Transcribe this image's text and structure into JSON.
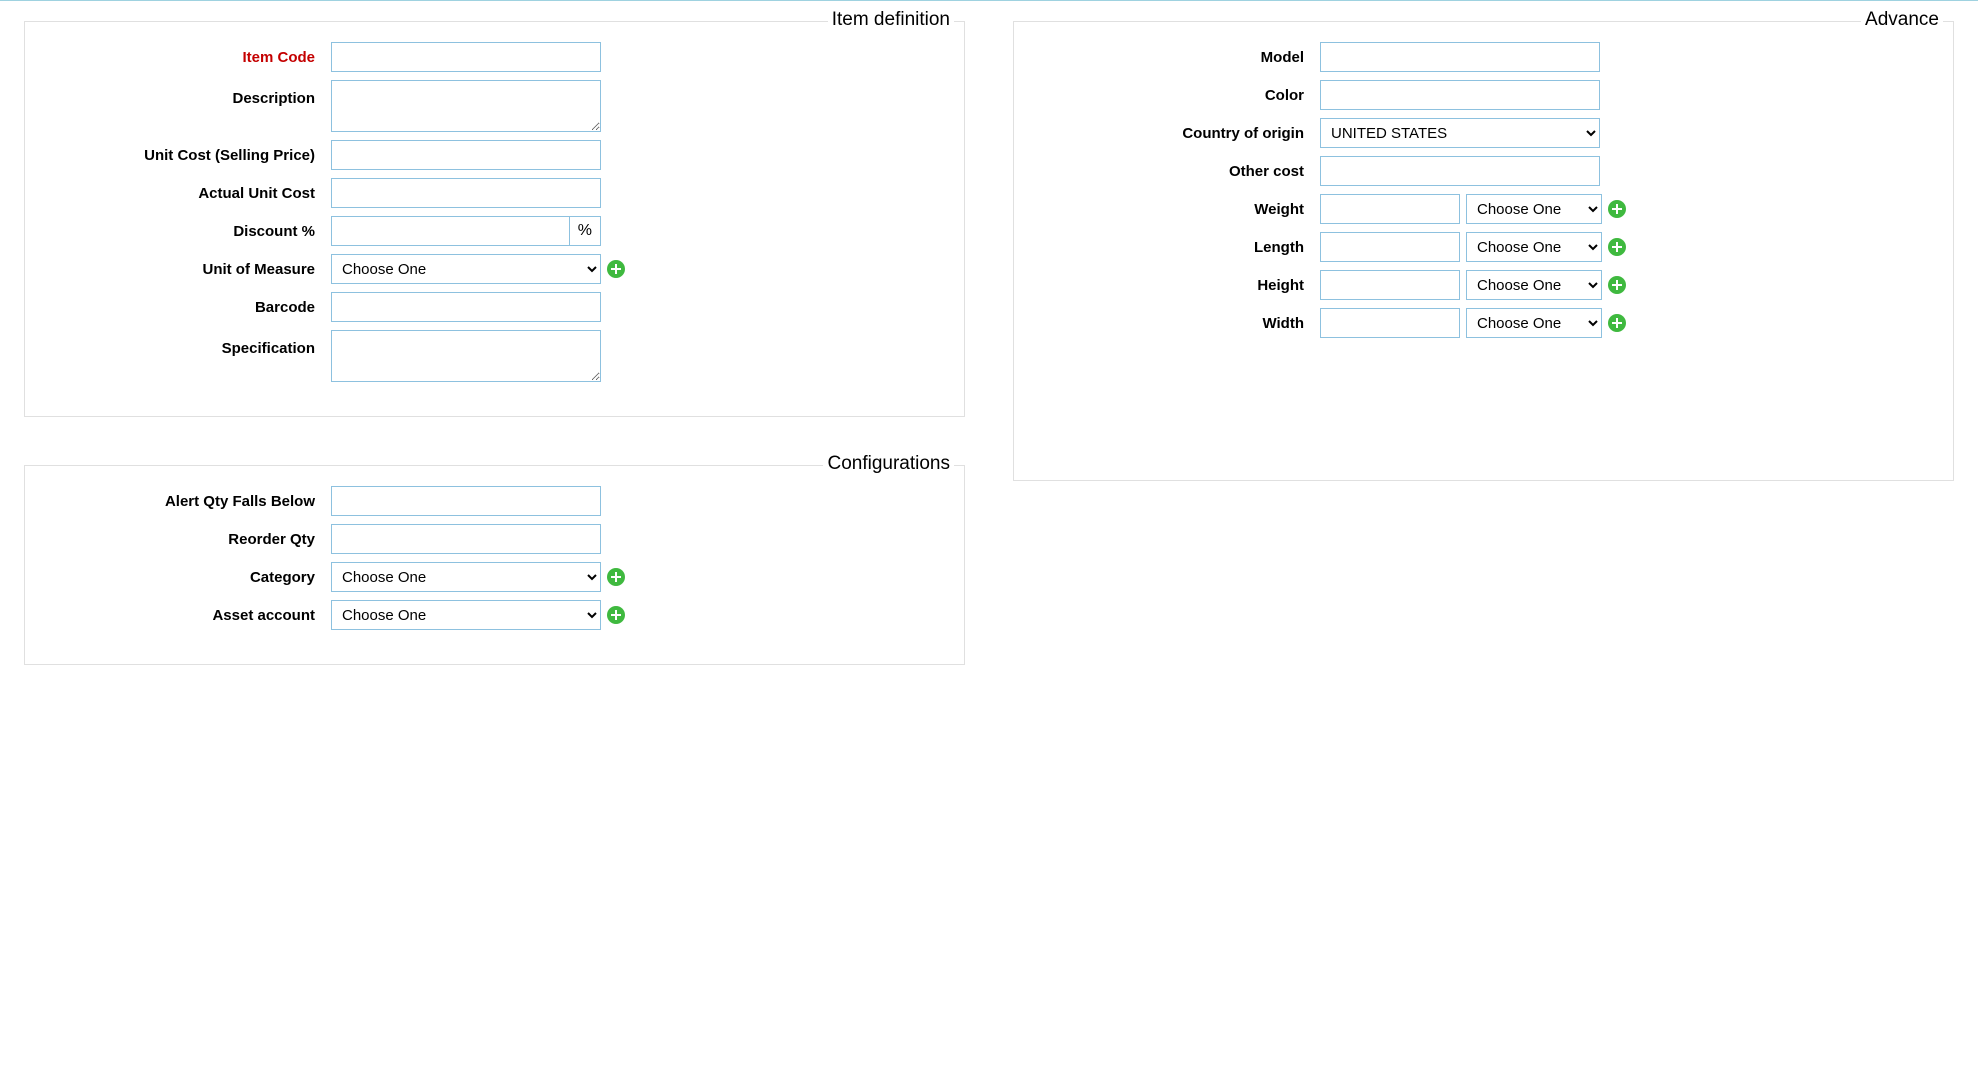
{
  "panels": {
    "item_definition": {
      "legend": "Item definition"
    },
    "configurations": {
      "legend": "Configurations"
    },
    "advance": {
      "legend": "Advance"
    }
  },
  "item_definition": {
    "item_code": {
      "label": "Item Code",
      "value": ""
    },
    "description": {
      "label": "Description",
      "value": ""
    },
    "unit_cost_selling": {
      "label": "Unit Cost (Selling Price)",
      "value": ""
    },
    "actual_unit_cost": {
      "label": "Actual Unit Cost",
      "value": ""
    },
    "discount_pct": {
      "label": "Discount %",
      "value": "",
      "suffix": "%"
    },
    "unit_of_measure": {
      "label": "Unit of Measure",
      "selected": "Choose One"
    },
    "barcode": {
      "label": "Barcode",
      "value": ""
    },
    "specification": {
      "label": "Specification",
      "value": ""
    }
  },
  "configurations": {
    "alert_qty": {
      "label": "Alert Qty Falls Below",
      "value": ""
    },
    "reorder_qty": {
      "label": "Reorder Qty",
      "value": ""
    },
    "category": {
      "label": "Category",
      "selected": "Choose One"
    },
    "asset_account": {
      "label": "Asset account",
      "selected": "Choose One"
    }
  },
  "advance": {
    "model": {
      "label": "Model",
      "value": ""
    },
    "color": {
      "label": "Color",
      "value": ""
    },
    "country_of_origin": {
      "label": "Country of origin",
      "selected": "UNITED STATES"
    },
    "other_cost": {
      "label": "Other cost",
      "value": ""
    },
    "weight": {
      "label": "Weight",
      "value": "",
      "unit_selected": "Choose One"
    },
    "length": {
      "label": "Length",
      "value": "",
      "unit_selected": "Choose One"
    },
    "height": {
      "label": "Height",
      "value": "",
      "unit_selected": "Choose One"
    },
    "width": {
      "label": "Width",
      "value": "",
      "unit_selected": "Choose One"
    }
  }
}
